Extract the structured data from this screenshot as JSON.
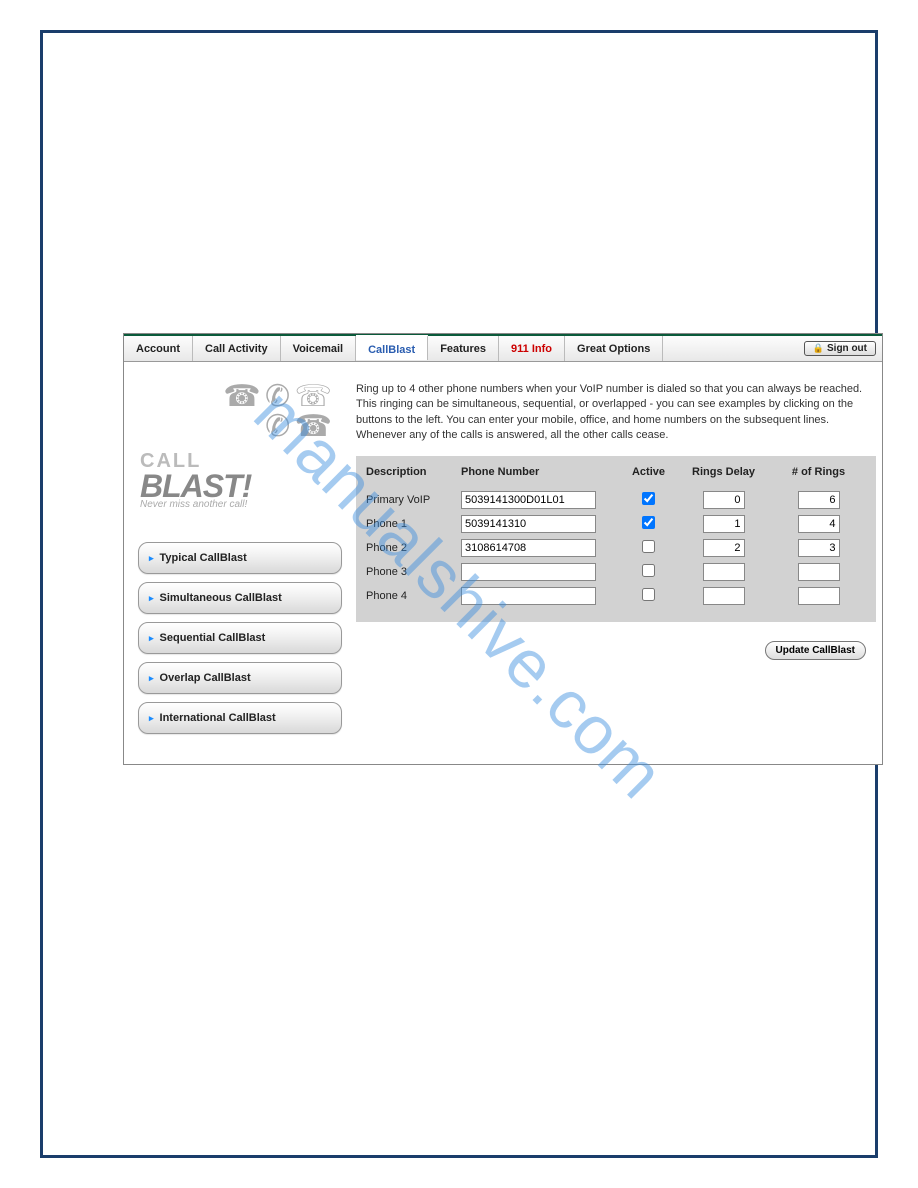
{
  "watermark": "manualshive.com",
  "tabs": {
    "account": "Account",
    "call_activity": "Call Activity",
    "voicemail": "Voicemail",
    "callblast": "CallBlast",
    "features": "Features",
    "info_911": "911 Info",
    "great_options": "Great Options"
  },
  "signout_label": "Sign out",
  "logo": {
    "call": "CALL",
    "blast": "BLAST!",
    "tag": "Never miss another call!"
  },
  "side_buttons": [
    "Typical CallBlast",
    "Simultaneous CallBlast",
    "Sequential CallBlast",
    "Overlap CallBlast",
    "International CallBlast"
  ],
  "intro": "Ring up to 4 other phone numbers when your VoIP number is dialed so that you can always be reached. This ringing can be simultaneous, sequential, or overlapped - you can see examples by clicking on the buttons to the left. You can enter your mobile, office, and home numbers on the subsequent lines. Whenever any of the calls is answered, all the other calls cease.",
  "headers": {
    "desc": "Description",
    "phone": "Phone Number",
    "active": "Active",
    "delay": "Rings Delay",
    "rings": "# of Rings"
  },
  "rows": [
    {
      "desc": "Primary VoIP",
      "phone": "5039141300D01L01",
      "active": true,
      "delay": "0",
      "rings": "6"
    },
    {
      "desc": "Phone 1",
      "phone": "5039141310",
      "active": true,
      "delay": "1",
      "rings": "4"
    },
    {
      "desc": "Phone 2",
      "phone": "3108614708",
      "active": false,
      "delay": "2",
      "rings": "3"
    },
    {
      "desc": "Phone 3",
      "phone": "",
      "active": false,
      "delay": "",
      "rings": ""
    },
    {
      "desc": "Phone 4",
      "phone": "",
      "active": false,
      "delay": "",
      "rings": ""
    }
  ],
  "update_label": "Update CallBlast"
}
